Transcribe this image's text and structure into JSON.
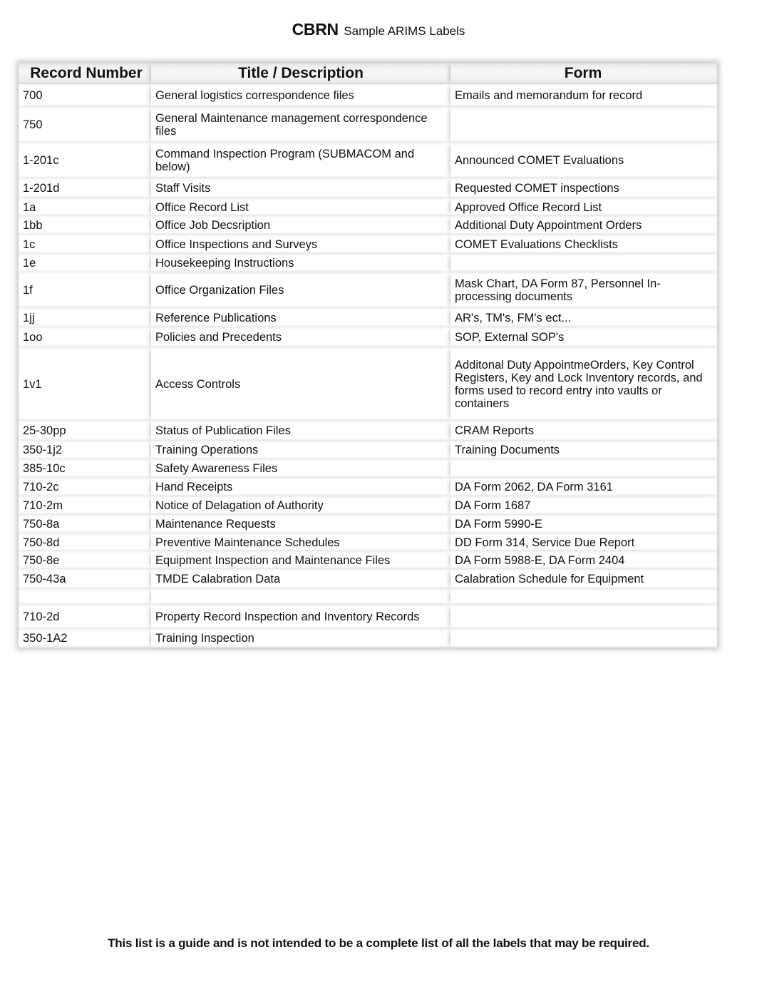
{
  "document": {
    "title_bold": "CBRN",
    "title_rest": "Sample ARIMS Labels",
    "footer_note": "This list is a guide and is not intended to be a complete list of all the labels that may be required."
  },
  "table": {
    "headers": [
      "Record Number",
      "Title / Description",
      "Form"
    ],
    "rows": [
      {
        "record": "700",
        "title": "General logistics correspondence files",
        "form": "Emails and memorandum for record"
      },
      {
        "record": "750",
        "title": "General Maintenance management correspondence files",
        "form": ""
      },
      {
        "record": "1-201c",
        "title": "Command Inspection Program (SUBMACOM and below)",
        "form": "Announced COMET Evaluations"
      },
      {
        "record": "1-201d",
        "title": "Staff Visits",
        "form": "Requested COMET inspections"
      },
      {
        "record": "1a",
        "title": "Office Record List",
        "form": "Approved Office Record List"
      },
      {
        "record": "1bb",
        "title": "Office Job Decsription",
        "form": "Additional Duty Appointment Orders"
      },
      {
        "record": "1c",
        "title": "Office Inspections and Surveys",
        "form": "COMET Evaluations Checklists"
      },
      {
        "record": "1e",
        "title": "Housekeeping Instructions",
        "form": ""
      },
      {
        "record": "1f",
        "title": "Office Organization Files",
        "form": "Mask Chart, DA Form 87, Personnel In-processing documents"
      },
      {
        "record": "1jj",
        "title": "Reference Publications",
        "form": "AR's, TM's, FM's ect..."
      },
      {
        "record": "1oo",
        "title": "Policies and Precedents",
        "form": "SOP, External SOP's"
      },
      {
        "record": "1v1",
        "title": "Access Controls",
        "form": "Additonal Duty AppointmeOrders, Key Control Registers, Key and Lock Inventory records, and forms used  to record entry into vaults or containers"
      },
      {
        "record": "25-30pp",
        "title": "Status of Publication Files",
        "form": "CRAM Reports"
      },
      {
        "record": "350-1j2",
        "title": "Training Operations",
        "form": "Training Documents"
      },
      {
        "record": "385-10c",
        "title": "Safety Awareness Files",
        "form": ""
      },
      {
        "record": "710-2c",
        "title": "Hand Receipts",
        "form": "DA Form 2062, DA Form 3161"
      },
      {
        "record": "710-2m",
        "title": "Notice of Delagation of Authority",
        "form": "DA Form 1687"
      },
      {
        "record": "750-8a",
        "title": "Maintenance Requests",
        "form": "DA Form 5990-E"
      },
      {
        "record": "750-8d",
        "title": "Preventive Maintenance Schedules",
        "form": "DD Form 314, Service Due Report"
      },
      {
        "record": "750-8e",
        "title": "Equipment Inspection and Maintenance Files",
        "form": "DA Form 5988-E, DA Form 2404"
      },
      {
        "record": "750-43a",
        "title": "TMDE Calabration Data",
        "form": "Calabration Schedule for Equipment"
      },
      {
        "record": "",
        "title": "",
        "form": ""
      },
      {
        "record": "710-2d",
        "title": "Property Record Inspection and Inventory Records",
        "form": ""
      },
      {
        "record": "350-1A2",
        "title": "Training Inspection",
        "form": ""
      }
    ]
  }
}
